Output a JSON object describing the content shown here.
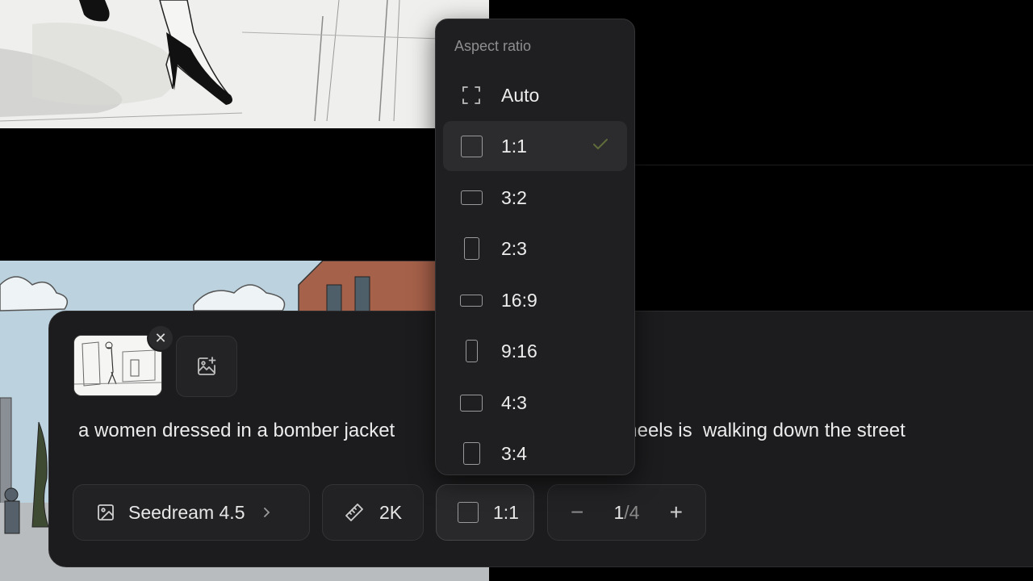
{
  "dropdown": {
    "header": "Aspect ratio",
    "items": [
      {
        "label": "Auto",
        "icon": "auto-frame-icon"
      },
      {
        "label": "1:1",
        "icon": "square-icon",
        "selected": true
      },
      {
        "label": "3:2",
        "icon": "landscape-3-2-icon"
      },
      {
        "label": "2:3",
        "icon": "portrait-2-3-icon"
      },
      {
        "label": "16:9",
        "icon": "landscape-16-9-icon"
      },
      {
        "label": "9:16",
        "icon": "portrait-9-16-icon"
      },
      {
        "label": "4:3",
        "icon": "landscape-4-3-icon"
      },
      {
        "label": "3:4",
        "icon": "portrait-3-4-icon"
      }
    ]
  },
  "prompt": {
    "text_left": "a women dressed in a bomber jacket",
    "text_right": "high heels is  walking down the street"
  },
  "toolbar": {
    "model": "Seedream 4.5",
    "resolution": "2K",
    "ratio": "1:1",
    "count_current": "1",
    "count_total": "/4"
  },
  "colors": {
    "panel_bg": "#1c1c1e",
    "dropdown_bg": "#1f1f21",
    "selected_bg": "#2c2c2e",
    "check_color": "#5f6b3a"
  }
}
